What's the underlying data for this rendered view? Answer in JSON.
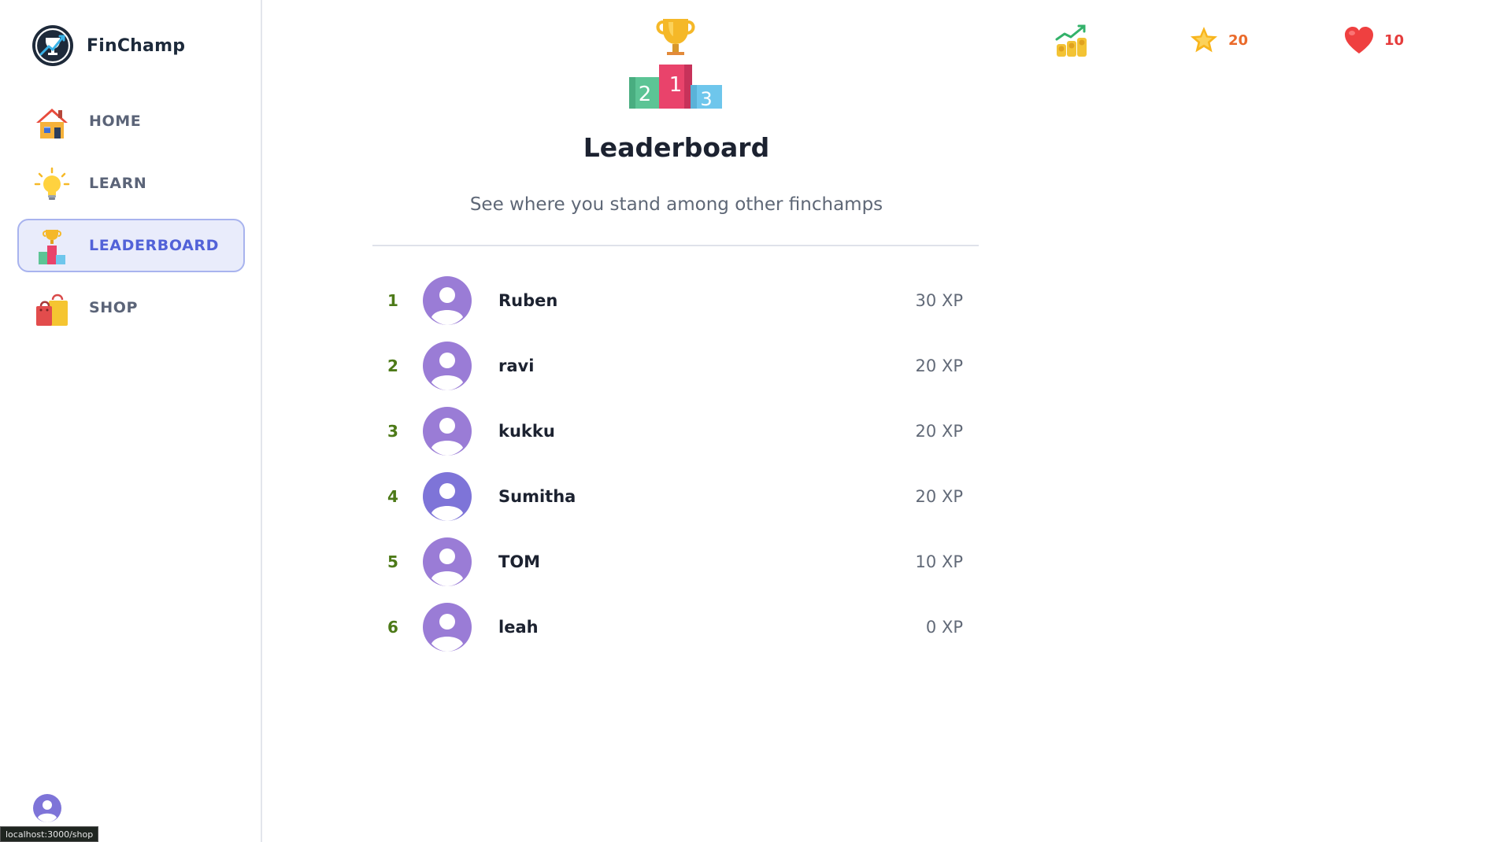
{
  "brand": {
    "name": "FinChamp"
  },
  "nav": {
    "items": [
      {
        "label": "HOME",
        "icon": "house-icon",
        "active": false
      },
      {
        "label": "LEARN",
        "icon": "lightbulb-icon",
        "active": false
      },
      {
        "label": "LEADERBOARD",
        "icon": "podium-icon",
        "active": true
      },
      {
        "label": "SHOP",
        "icon": "shopping-bags-icon",
        "active": false
      }
    ]
  },
  "stats": {
    "coins_icon": "money-growth-icon",
    "xp": {
      "icon": "star-icon",
      "value": "20"
    },
    "hearts": {
      "icon": "heart-icon",
      "value": "10"
    }
  },
  "leaderboard": {
    "title": "Leaderboard",
    "subtitle": "See where you stand among other finchamps",
    "entries": [
      {
        "rank": "1",
        "name": "Ruben",
        "xp": "30 XP"
      },
      {
        "rank": "2",
        "name": "ravi",
        "xp": "20 XP"
      },
      {
        "rank": "3",
        "name": "kukku",
        "xp": "20 XP"
      },
      {
        "rank": "4",
        "name": "Sumitha",
        "xp": "20 XP"
      },
      {
        "rank": "5",
        "name": "TOM",
        "xp": "10 XP"
      },
      {
        "rank": "6",
        "name": "leah",
        "xp": "0 XP"
      }
    ]
  },
  "status_bar": {
    "url": "localhost:3000/shop"
  },
  "colors": {
    "accent": "#5262d8",
    "active_bg": "#e9ecfb",
    "rank_green": "#4d7a18",
    "xp_orange": "#ea6a2a",
    "heart_red": "#e53c3c",
    "avatar_purple": "#9a7cd6"
  }
}
